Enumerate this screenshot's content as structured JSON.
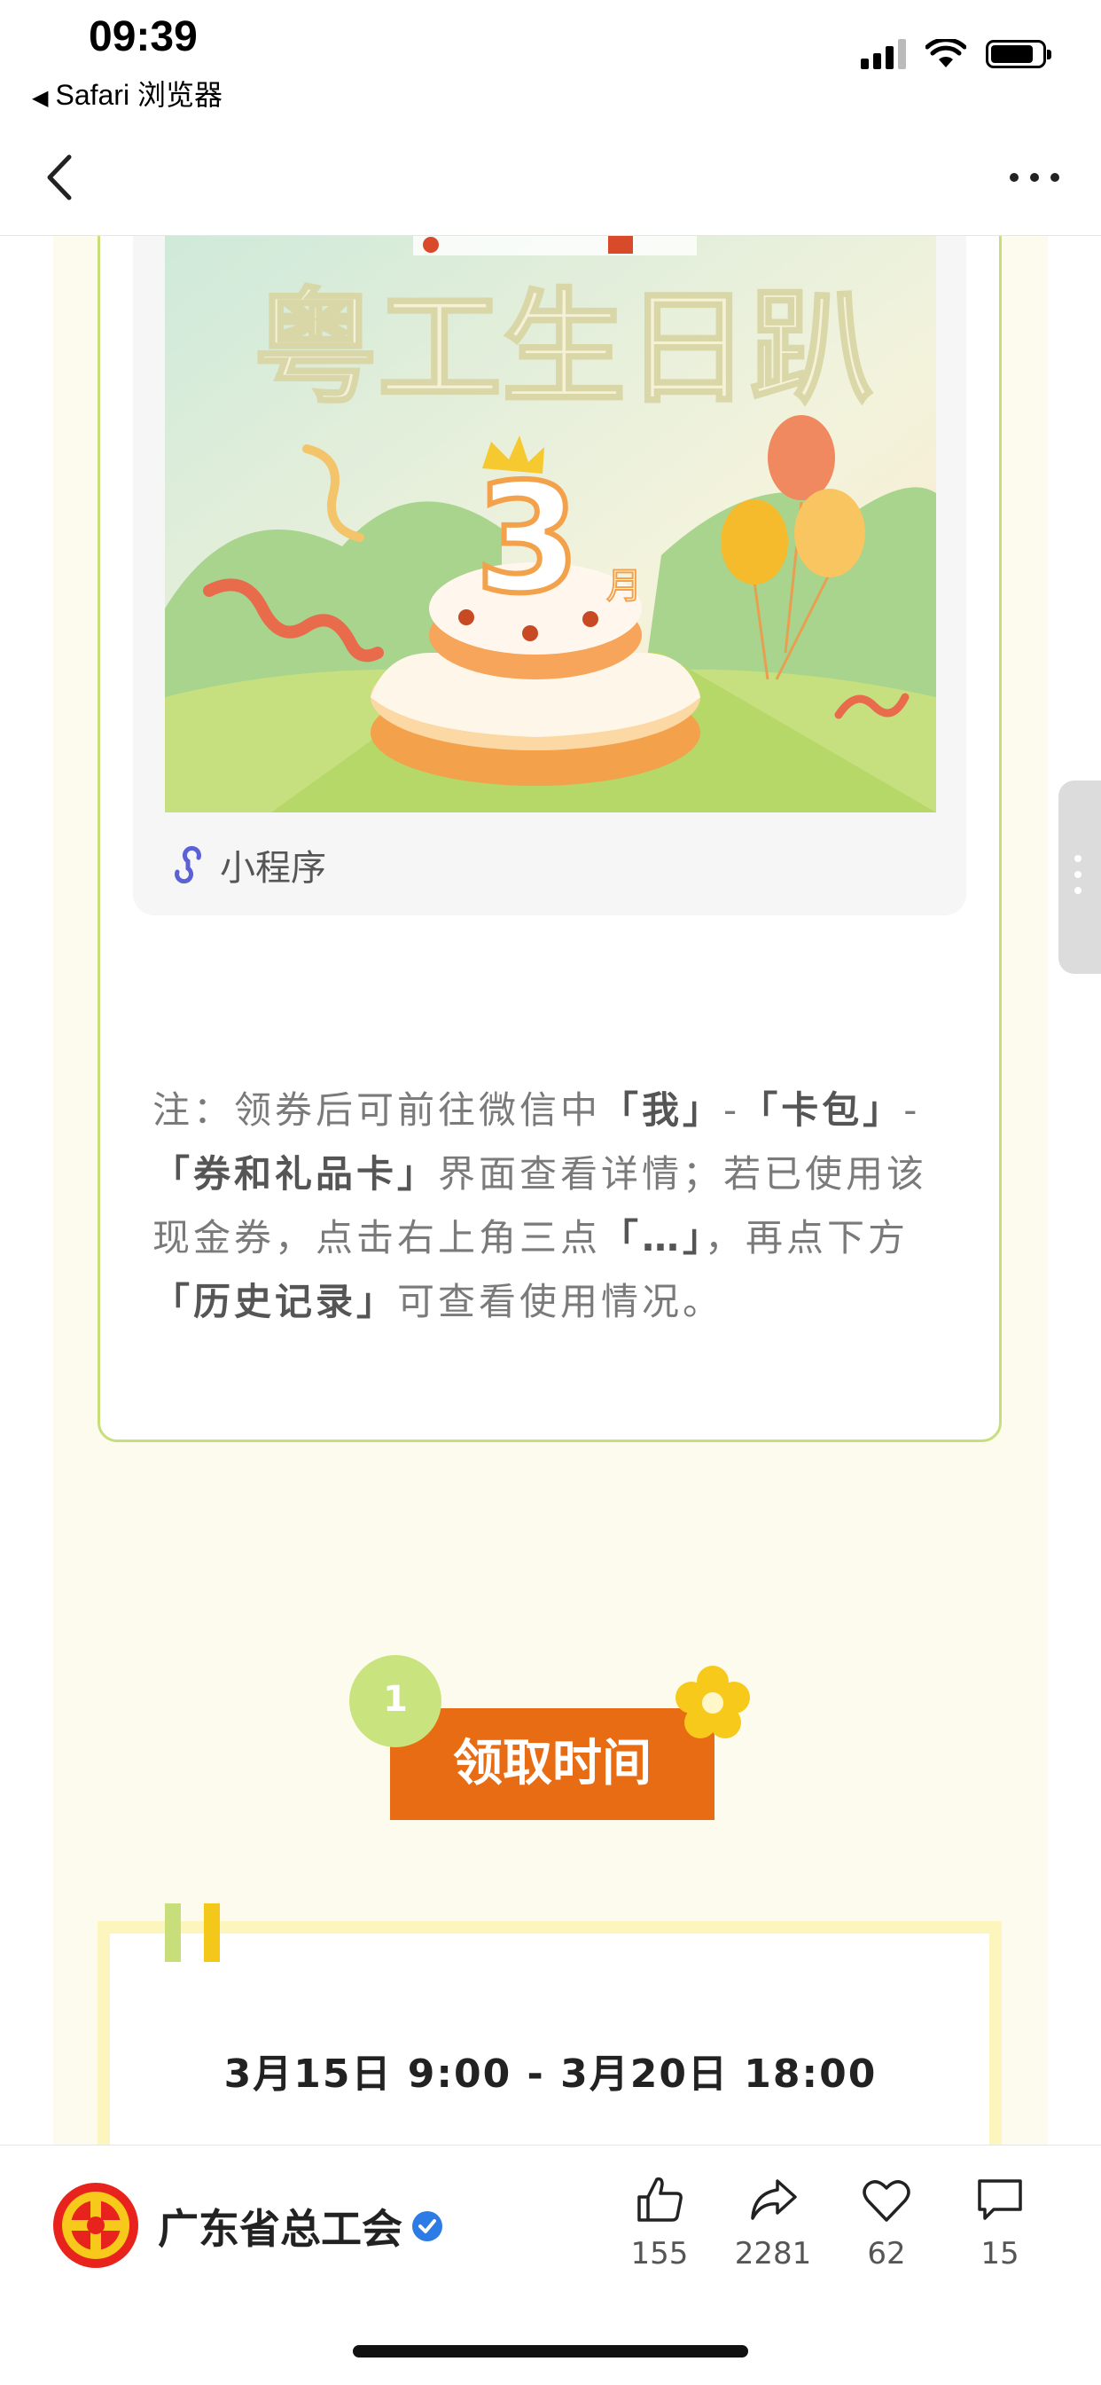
{
  "status_bar": {
    "time": "09:39",
    "back_app": "Safari 浏览器"
  },
  "mini_program": {
    "label": "小程序"
  },
  "note": {
    "p1": "注：领券后可前往微信中",
    "b1": "「我」",
    "p2": "-",
    "b2": "「卡包」",
    "p3": "-",
    "b3": "「券和礼品卡」",
    "p4": "界面查看详情；若已使用该现金券，点击右上角三点",
    "b4": "「…」",
    "p5": "，再点下方",
    "b5": "「历史记录」",
    "p6": "可查看使用情况。"
  },
  "section": {
    "number": "1",
    "title": "领取时间"
  },
  "date_range": "3月15日 9:00 - 3月20日 18:00",
  "account": {
    "name": "广东省总工会"
  },
  "actions": [
    {
      "name": "like",
      "count": "155"
    },
    {
      "name": "share",
      "count": "2281"
    },
    {
      "name": "favorite",
      "count": "62"
    },
    {
      "name": "comment",
      "count": "15"
    }
  ],
  "colors": {
    "accent_orange": "#e86c14",
    "accent_green": "#c7de7a",
    "cream": "#fdfbee"
  }
}
